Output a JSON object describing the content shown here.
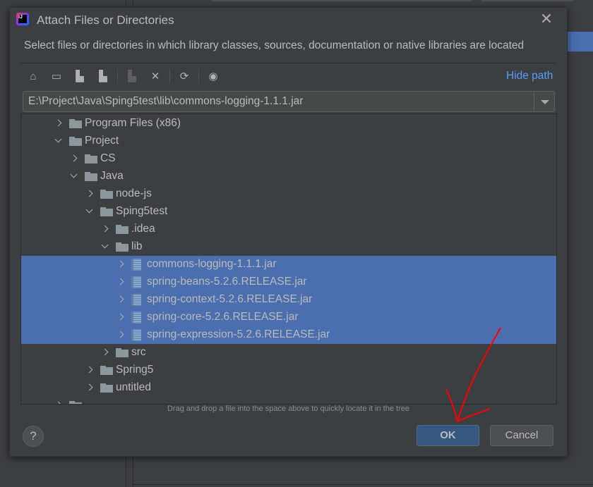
{
  "dialog": {
    "title": "Attach Files or Directories",
    "description": "Select files or directories in which library classes, sources, documentation or native libraries are located",
    "hide_path_label": "Hide path",
    "path_value": "E:\\Project\\Java\\Sping5test\\lib\\commons-logging-1.1.1.jar",
    "drag_hint": "Drag and drop a file into the space above to quickly locate it in the tree",
    "ok_label": "OK",
    "cancel_label": "Cancel",
    "help_label": "?",
    "close_label": "✕"
  },
  "toolbar": [
    {
      "icon": "home-icon",
      "glyph": "⌂",
      "enabled": true
    },
    {
      "icon": "desktop-icon",
      "glyph": "▭",
      "enabled": true
    },
    {
      "icon": "project-folder-icon",
      "glyph": "▙",
      "enabled": true
    },
    {
      "icon": "module-folder-icon",
      "glyph": "▙",
      "enabled": true
    },
    {
      "sep": true
    },
    {
      "icon": "new-folder-icon",
      "glyph": "▙",
      "enabled": false
    },
    {
      "icon": "delete-icon",
      "glyph": "✕",
      "enabled": true
    },
    {
      "sep": true
    },
    {
      "icon": "refresh-icon",
      "glyph": "⟳",
      "enabled": true
    },
    {
      "sep": true
    },
    {
      "icon": "show-hidden-icon",
      "glyph": "◉",
      "enabled": true
    }
  ],
  "tree": [
    {
      "label": "Program Files (x86)",
      "level": 0,
      "expanded": false,
      "type": "folder",
      "selected": false
    },
    {
      "label": "Project",
      "level": 0,
      "expanded": true,
      "type": "folder",
      "selected": false
    },
    {
      "label": "CS",
      "level": 1,
      "expanded": false,
      "type": "folder",
      "selected": false
    },
    {
      "label": "Java",
      "level": 1,
      "expanded": true,
      "type": "folder",
      "selected": false
    },
    {
      "label": "node-js",
      "level": 2,
      "expanded": false,
      "type": "folder",
      "selected": false
    },
    {
      "label": "Sping5test",
      "level": 2,
      "expanded": true,
      "type": "folder",
      "selected": false
    },
    {
      "label": ".idea",
      "level": 3,
      "expanded": false,
      "type": "folder",
      "selected": false
    },
    {
      "label": "lib",
      "level": 3,
      "expanded": true,
      "type": "folder",
      "selected": false
    },
    {
      "label": "commons-logging-1.1.1.jar",
      "level": 4,
      "expanded": false,
      "type": "jar",
      "selected": true
    },
    {
      "label": "spring-beans-5.2.6.RELEASE.jar",
      "level": 4,
      "expanded": false,
      "type": "jar",
      "selected": true
    },
    {
      "label": "spring-context-5.2.6.RELEASE.jar",
      "level": 4,
      "expanded": false,
      "type": "jar",
      "selected": true
    },
    {
      "label": "spring-core-5.2.6.RELEASE.jar",
      "level": 4,
      "expanded": false,
      "type": "jar",
      "selected": true
    },
    {
      "label": "spring-expression-5.2.6.RELEASE.jar",
      "level": 4,
      "expanded": false,
      "type": "jar",
      "selected": true
    },
    {
      "label": "src",
      "level": 3,
      "expanded": false,
      "type": "folder",
      "selected": false
    },
    {
      "label": "Spring5",
      "level": 2,
      "expanded": false,
      "type": "folder",
      "selected": false
    },
    {
      "label": "untitled",
      "level": 2,
      "expanded": false,
      "type": "folder",
      "selected": false
    },
    {
      "label": "",
      "level": 0,
      "expanded": false,
      "type": "folder",
      "selected": false
    }
  ],
  "colors": {
    "selection": "#4b6eaf",
    "link": "#589df6",
    "ok_button": "#365880",
    "annotation_arrow": "#ff0000"
  }
}
